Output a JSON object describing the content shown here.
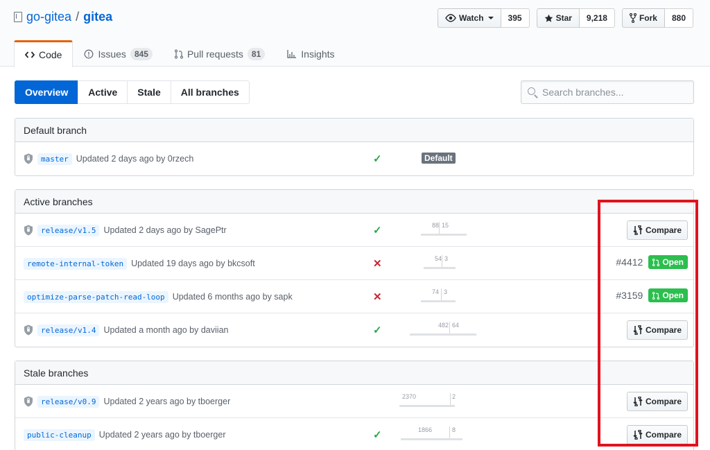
{
  "repo": {
    "owner": "go-gitea",
    "separator": "/",
    "name": "gitea"
  },
  "actions": [
    {
      "label": "Watch",
      "count": "395",
      "icon": "eye-icon",
      "dropdown": true
    },
    {
      "label": "Star",
      "count": "9,218",
      "icon": "star-icon",
      "dropdown": false
    },
    {
      "label": "Fork",
      "count": "880",
      "icon": "fork-icon",
      "dropdown": false
    }
  ],
  "reponav": [
    {
      "label": "Code",
      "counter": "",
      "icon": "code-icon",
      "selected": true
    },
    {
      "label": "Issues",
      "counter": "845",
      "icon": "issue-icon",
      "selected": false
    },
    {
      "label": "Pull requests",
      "counter": "81",
      "icon": "pull-request-icon",
      "selected": false
    },
    {
      "label": "Insights",
      "counter": "",
      "icon": "graph-icon",
      "selected": false
    }
  ],
  "subnav": [
    "Overview",
    "Active",
    "Stale",
    "All branches"
  ],
  "search": {
    "placeholder": "Search branches..."
  },
  "sections": {
    "default": {
      "title": "Default branch",
      "rows": [
        {
          "name": "master",
          "updated": "Updated 2 days ago by 0rzech",
          "protected": true,
          "status": "success",
          "label": "Default"
        }
      ]
    },
    "active": {
      "title": "Active branches",
      "rows": [
        {
          "name": "release/v1.5",
          "updated": "Updated 2 days ago by SagePtr",
          "protected": true,
          "status": "success",
          "behind": "88",
          "ahead": "15",
          "action": "Compare"
        },
        {
          "name": "remote-internal-token",
          "updated": "Updated 19 days ago by bkcsoft",
          "protected": false,
          "status": "failure",
          "behind": "54",
          "ahead": "3",
          "pr_number": "#4412",
          "pr_state": "Open"
        },
        {
          "name": "optimize-parse-patch-read-loop",
          "updated": "Updated 6 months ago by sapk",
          "protected": false,
          "status": "failure",
          "behind": "74",
          "ahead": "3",
          "pr_number": "#3159",
          "pr_state": "Open"
        },
        {
          "name": "release/v1.4",
          "updated": "Updated a month ago by daviian",
          "protected": true,
          "status": "success",
          "behind": "482",
          "ahead": "64",
          "action": "Compare"
        }
      ]
    },
    "stale": {
      "title": "Stale branches",
      "rows": [
        {
          "name": "release/v0.9",
          "updated": "Updated 2 years ago by tboerger",
          "protected": true,
          "status": "none",
          "behind": "2370",
          "ahead": "2",
          "action": "Compare"
        },
        {
          "name": "public-cleanup",
          "updated": "Updated 2 years ago by tboerger",
          "protected": false,
          "status": "success",
          "behind": "1866",
          "ahead": "8",
          "action": "Compare"
        }
      ]
    }
  },
  "glyphs": {
    "check": "✓",
    "cross": "✕"
  },
  "colors": {
    "link": "#0366d6",
    "success": "#28a745",
    "failure": "#cb2431",
    "open": "#2cbe4e",
    "highlight": "#e0131e",
    "selected_tab_border": "#e36209"
  }
}
